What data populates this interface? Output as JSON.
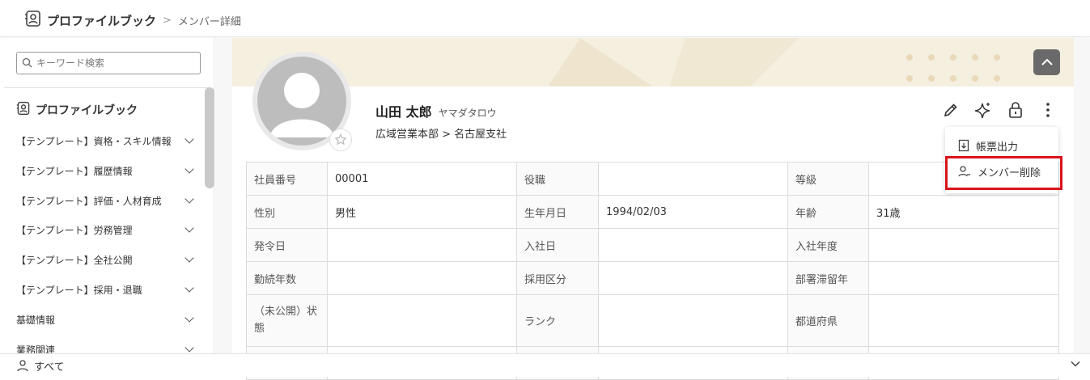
{
  "breadcrumb": {
    "title": "プロファイルブック",
    "current": "メンバー詳細"
  },
  "sidebar": {
    "search_placeholder": "キーワード検索",
    "heading": "プロファイルブック",
    "items": [
      {
        "label": "【テンプレート】資格・スキル情報"
      },
      {
        "label": "【テンプレート】履歴情報"
      },
      {
        "label": "【テンプレート】評価・人材育成"
      },
      {
        "label": "【テンプレート】労務管理"
      },
      {
        "label": "【テンプレート】全社公開"
      },
      {
        "label": "【テンプレート】採用・退職"
      },
      {
        "label": "基礎情報"
      },
      {
        "label": "業務関連"
      }
    ]
  },
  "bottombar": {
    "label": "すべて"
  },
  "profile": {
    "name": "山田 太郎",
    "kana": "ヤマダタロウ",
    "department": "広域営業本部 > 名古屋支社"
  },
  "menu": {
    "items": [
      {
        "label": "帳票出力"
      },
      {
        "label": "メンバー削除"
      }
    ]
  },
  "table": {
    "rows": [
      [
        {
          "label": "社員番号",
          "value": "00001"
        },
        {
          "label": "役職",
          "value": ""
        },
        {
          "label": "等級",
          "value": ""
        }
      ],
      [
        {
          "label": "性別",
          "value": "男性"
        },
        {
          "label": "生年月日",
          "value": "1994/02/03"
        },
        {
          "label": "年齢",
          "value": "31歳"
        }
      ],
      [
        {
          "label": "発令日",
          "value": ""
        },
        {
          "label": "入社日",
          "value": ""
        },
        {
          "label": "入社年度",
          "value": ""
        }
      ],
      [
        {
          "label": "勤続年数",
          "value": ""
        },
        {
          "label": "採用区分",
          "value": ""
        },
        {
          "label": "部署滞留年",
          "value": ""
        }
      ],
      [
        {
          "label": "（未公開）状態",
          "value": ""
        },
        {
          "label": "ランク",
          "value": ""
        },
        {
          "label": "都道府県",
          "value": ""
        }
      ]
    ]
  },
  "colors": {
    "highlight": "#d9141b",
    "banner": "#f5efe0",
    "up_button": "#6a6a6a"
  }
}
